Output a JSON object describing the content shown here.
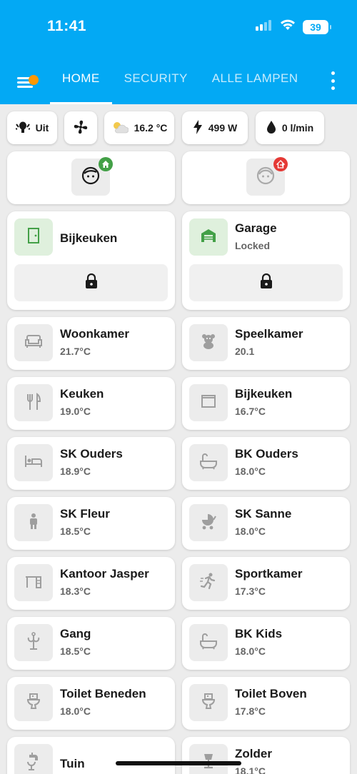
{
  "status_bar": {
    "time": "11:41",
    "battery": "39"
  },
  "tabs": [
    {
      "label": "HOME",
      "active": true
    },
    {
      "label": "SECURITY",
      "active": false
    },
    {
      "label": "ALLE LAMPEN",
      "active": false
    }
  ],
  "chips": [
    {
      "icon": "air-conditioner-icon",
      "label": "Uit"
    },
    {
      "icon": "fan-icon",
      "label": ""
    },
    {
      "icon": "partly-cloudy-icon",
      "label": "16.2 °C"
    },
    {
      "icon": "lightning-bolt-icon",
      "label": "499 W"
    },
    {
      "icon": "water-drop-icon",
      "label": "0 l/min"
    }
  ],
  "persons": [
    {
      "icon": "person-face-icon",
      "badge": "home-badge-icon",
      "badge_color": "#43a047",
      "state": "home"
    },
    {
      "icon": "person-face-icon",
      "badge": "away-badge-icon",
      "badge_color": "#e53935",
      "state": "away"
    }
  ],
  "doors": [
    {
      "name": "Bijkeuken",
      "state": "",
      "icon": "door-icon",
      "lock_icon": "lock-icon"
    },
    {
      "name": "Garage",
      "state": "Locked",
      "icon": "garage-icon",
      "lock_icon": "lock-icon"
    }
  ],
  "rooms": [
    {
      "name": "Woonkamer",
      "temp": "21.7°C",
      "icon": "sofa-icon"
    },
    {
      "name": "Speelkamer",
      "temp": "20.1",
      "icon": "teddy-bear-icon"
    },
    {
      "name": "Keuken",
      "temp": "19.0°C",
      "icon": "cutlery-icon"
    },
    {
      "name": "Bijkeuken",
      "temp": "16.7°C",
      "icon": "window-icon"
    },
    {
      "name": "SK Ouders",
      "temp": "18.9°C",
      "icon": "bed-icon"
    },
    {
      "name": "BK Ouders",
      "temp": "18.0°C",
      "icon": "bathtub-icon"
    },
    {
      "name": "SK Fleur",
      "temp": "18.5°C",
      "icon": "child-icon"
    },
    {
      "name": "SK Sanne",
      "temp": "18.0°C",
      "icon": "baby-carriage-icon"
    },
    {
      "name": "Kantoor Jasper",
      "temp": "18.3°C",
      "icon": "desk-icon"
    },
    {
      "name": "Sportkamer",
      "temp": "17.3°C",
      "icon": "running-icon"
    },
    {
      "name": "Gang",
      "temp": "18.5°C",
      "icon": "coat-rack-icon"
    },
    {
      "name": "BK Kids",
      "temp": "18.0°C",
      "icon": "bathtub-icon"
    },
    {
      "name": "Toilet Beneden",
      "temp": "18.0°C",
      "icon": "toilet-icon"
    },
    {
      "name": "Toilet Boven",
      "temp": "17.8°C",
      "icon": "toilet-icon"
    },
    {
      "name": "Tuin",
      "temp": "",
      "icon": "watering-tap-icon"
    },
    {
      "name": "Zolder",
      "temp": "18.1°C",
      "icon": "attic-lamp-icon"
    }
  ],
  "colors": {
    "header": "#03a9f4",
    "accent_dot": "#ff9800",
    "home_badge": "#43a047",
    "away_badge": "#e53935",
    "door_icon": "#43a047"
  }
}
